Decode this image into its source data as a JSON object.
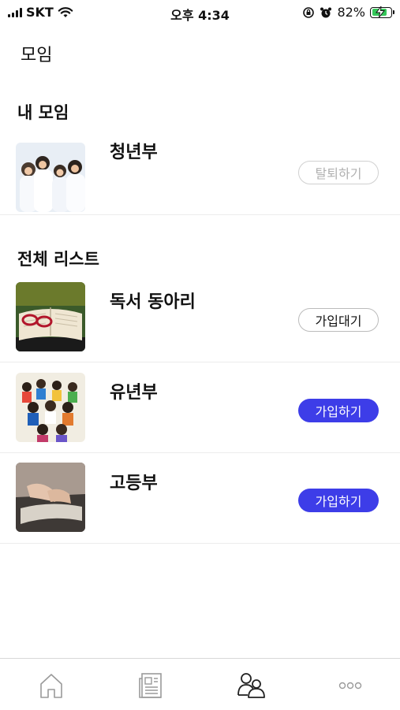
{
  "status_bar": {
    "carrier": "SKT",
    "time": "오후 4:34",
    "battery_percent": "82%",
    "battery_level": 0.82
  },
  "page": {
    "title": "모임"
  },
  "my_groups": {
    "title": "내 모임",
    "items": [
      {
        "name": "청년부",
        "action_label": "탈퇴하기",
        "thumb_icon": "youth-group-photo"
      }
    ]
  },
  "all_list": {
    "title": "전체 리스트",
    "items": [
      {
        "name": "독서 동아리",
        "action_label": "가입대기",
        "thumb_icon": "book-glasses-photo"
      },
      {
        "name": "유년부",
        "action_label": "가입하기",
        "thumb_icon": "children-group-photo"
      },
      {
        "name": "고등부",
        "action_label": "가입하기",
        "thumb_icon": "reading-hands-photo"
      }
    ]
  },
  "colors": {
    "accent": "#3d3de8",
    "leave_border": "#d0d0d0",
    "battery_green": "#34c759"
  },
  "tab_bar": {
    "tabs": [
      {
        "icon": "home-icon",
        "active": false
      },
      {
        "icon": "news-icon",
        "active": false
      },
      {
        "icon": "group-icon",
        "active": true
      },
      {
        "icon": "more-icon",
        "active": false
      }
    ]
  }
}
